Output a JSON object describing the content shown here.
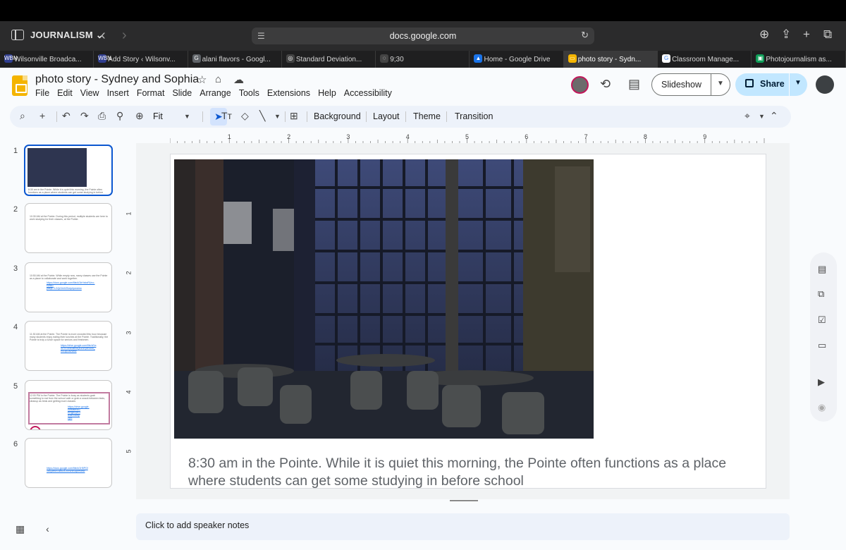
{
  "browser": {
    "group_label": "JOURNALISM",
    "address": "docs.google.com",
    "tabs": [
      {
        "label": "Wilsonville Broadca...",
        "fav_color": "#2f3d8f",
        "fav_glyph": "WBN"
      },
      {
        "label": "Add Story ‹ Wilsonv...",
        "fav_color": "#2f3d8f",
        "fav_glyph": "WBN"
      },
      {
        "label": "alani flavors - Googl...",
        "fav_color": "#5f6368",
        "fav_glyph": "G"
      },
      {
        "label": "Standard Deviation...",
        "fav_color": "#444",
        "fav_glyph": "◎"
      },
      {
        "label": "9;30",
        "fav_color": "#444",
        "fav_glyph": "◌"
      },
      {
        "label": "Home - Google Drive",
        "fav_color": "#1a73e8",
        "fav_glyph": "▲"
      },
      {
        "label": "photo story - Sydn...",
        "fav_color": "#f4b400",
        "fav_glyph": "▭"
      },
      {
        "label": "Classroom Manage...",
        "fav_color": "#fff",
        "fav_glyph": "G"
      },
      {
        "label": "Photojournalism as...",
        "fav_color": "#0f9d58",
        "fav_glyph": "▣"
      }
    ],
    "active_tab": 6
  },
  "doc": {
    "title": "photo story - Sydney and Sophia",
    "menu": [
      "File",
      "Edit",
      "View",
      "Insert",
      "Format",
      "Slide",
      "Arrange",
      "Tools",
      "Extensions",
      "Help",
      "Accessibility"
    ],
    "slideshow_label": "Slideshow",
    "share_label": "Share"
  },
  "toolbar": {
    "zoom": "Fit",
    "background_label": "Background",
    "layout_label": "Layout",
    "theme_label": "Theme",
    "transition_label": "Transition"
  },
  "filmstrip": [
    {
      "num": "1",
      "text": "8:30 am in the Pointe. While it is quiet this morning, the Pointe often functions as a place where students can get some studying in before school",
      "has_image": true
    },
    {
      "num": "2",
      "text": "10:30 AM at the Pointe. During this period, multiple students are here to work studying for their classes, at the Pointe."
    },
    {
      "num": "3",
      "text": "10:50 AM at the Pointe. While empty now, many classes use the Pointe as a place to collaborate and work together.",
      "link": "https://docs.google.com/file/d/1bHnbxRUno-rVtwG pa6jK7LGQrDhXfZ5zlpt/preview"
    },
    {
      "num": "4",
      "text": "11:30 AM at the Pointe. The Pointe is more crowded this hour because many students enjoy eating their lunches at the Pointe. Traditionally, the Pointe is truly a lunch space for seniors and freshmen.",
      "link": "https://drive.google.com/file/d/1a 4XYx7nxEdbv5Qc1NFprRD4x_ Rl33pUaI/view"
    },
    {
      "num": "5",
      "text": "12:00 PM in the Pointe. The Pointe is busy as students grab something to eat from the school cafe or grab a snack between tests, cleanup as tests and getting more classes",
      "link": "https://drive.google. com/file/d/1 ePfgbDpK3 d4Bv0aWp ZpA",
      "boxed": true
    },
    {
      "num": "6",
      "text": "",
      "link": "https://docs.google.com/file/d/1H5PGf 1MQlzhz4 wwLcCnXW4n3/preview"
    }
  ],
  "slide": {
    "caption": "8:30 am in the Pointe. While it is quiet this morning, the Pointe often functions as a place where students can get some studying in before school"
  },
  "ruler": {
    "top": [
      "1",
      "2",
      "3",
      "4",
      "5",
      "6",
      "7",
      "8",
      "9"
    ],
    "left": [
      "1",
      "2",
      "3",
      "4",
      "5"
    ]
  },
  "notes": {
    "placeholder": "Click to add speaker notes"
  }
}
